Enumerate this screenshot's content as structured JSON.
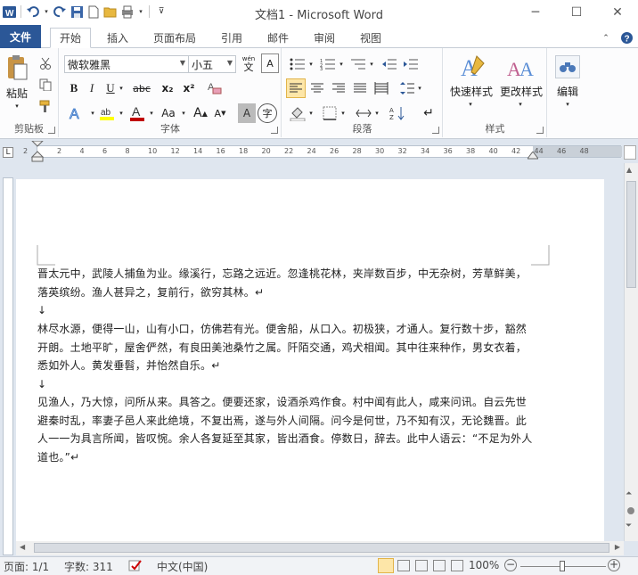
{
  "window": {
    "title": "文档1 - Microsoft Word",
    "minimize_icon": "minimize-icon",
    "restore_icon": "restore-icon",
    "close_icon": "close-icon"
  },
  "tabs": {
    "file": "文件",
    "home": "开始",
    "insert": "插入",
    "layout": "页面布局",
    "references": "引用",
    "mailings": "邮件",
    "review": "审阅",
    "view": "视图"
  },
  "ribbon": {
    "clipboard": {
      "paste": "粘贴",
      "label": "剪贴板"
    },
    "font": {
      "name": "微软雅黑",
      "size": "小五",
      "label": "字体",
      "bold": "B",
      "italic": "I",
      "underline": "U",
      "strike": "abc",
      "sub": "x₂",
      "sup": "x²",
      "fontcolor": "A",
      "case": "Aa",
      "grow": "A",
      "shrink": "A",
      "clear": "A",
      "phonetic": "wén",
      "charborder": "A",
      "enclose": "字"
    },
    "paragraph": {
      "label": "段落"
    },
    "styles": {
      "quick": "快速样式",
      "change": "更改样式",
      "label": "样式"
    },
    "editing": {
      "label": "编辑"
    }
  },
  "ruler": {
    "ticks": [
      "2",
      "2",
      "4",
      "6",
      "8",
      "10",
      "12",
      "14",
      "16",
      "18",
      "20",
      "22",
      "24",
      "26",
      "28",
      "30",
      "32",
      "34",
      "36",
      "38",
      "40",
      "42",
      "44",
      "46",
      "48"
    ]
  },
  "document": {
    "p1": "晋太元中，武陵人捕鱼为业。缘溪行，忘路之远近。忽逢桃花林，夹岸数百步，中无杂树，芳草鲜美，落英缤纷。渔人甚异之，复前行，欲穷其林。↵",
    "blank1": "↓",
    "p2": "林尽水源，便得一山，山有小口，仿佛若有光。便舍船，从口入。初极狭，才通人。复行数十步，豁然开朗。土地平旷，屋舍俨然，有良田美池桑竹之属。阡陌交通，鸡犬相闻。其中往来种作，男女衣着，悉如外人。黄发垂髫，并怡然自乐。↵",
    "blank2": "↓",
    "p3": "见渔人，乃大惊，问所从来。具答之。便要还家，设酒杀鸡作食。村中闻有此人，咸来问讯。自云先世避秦时乱，率妻子邑人来此绝境，不复出焉，遂与外人间隔。问今是何世，乃不知有汉，无论魏晋。此人一一为具言所闻，皆叹惋。余人各复延至其家，皆出酒食。停数日，辞去。此中人语云：“不足为外人道也。”↵"
  },
  "status": {
    "page": "页面: 1/1",
    "words": "字数: 311",
    "lang": "中文(中国)",
    "zoom": "100%"
  },
  "colors": {
    "file_tab": "#2b5797",
    "accent": "#2b5797"
  }
}
